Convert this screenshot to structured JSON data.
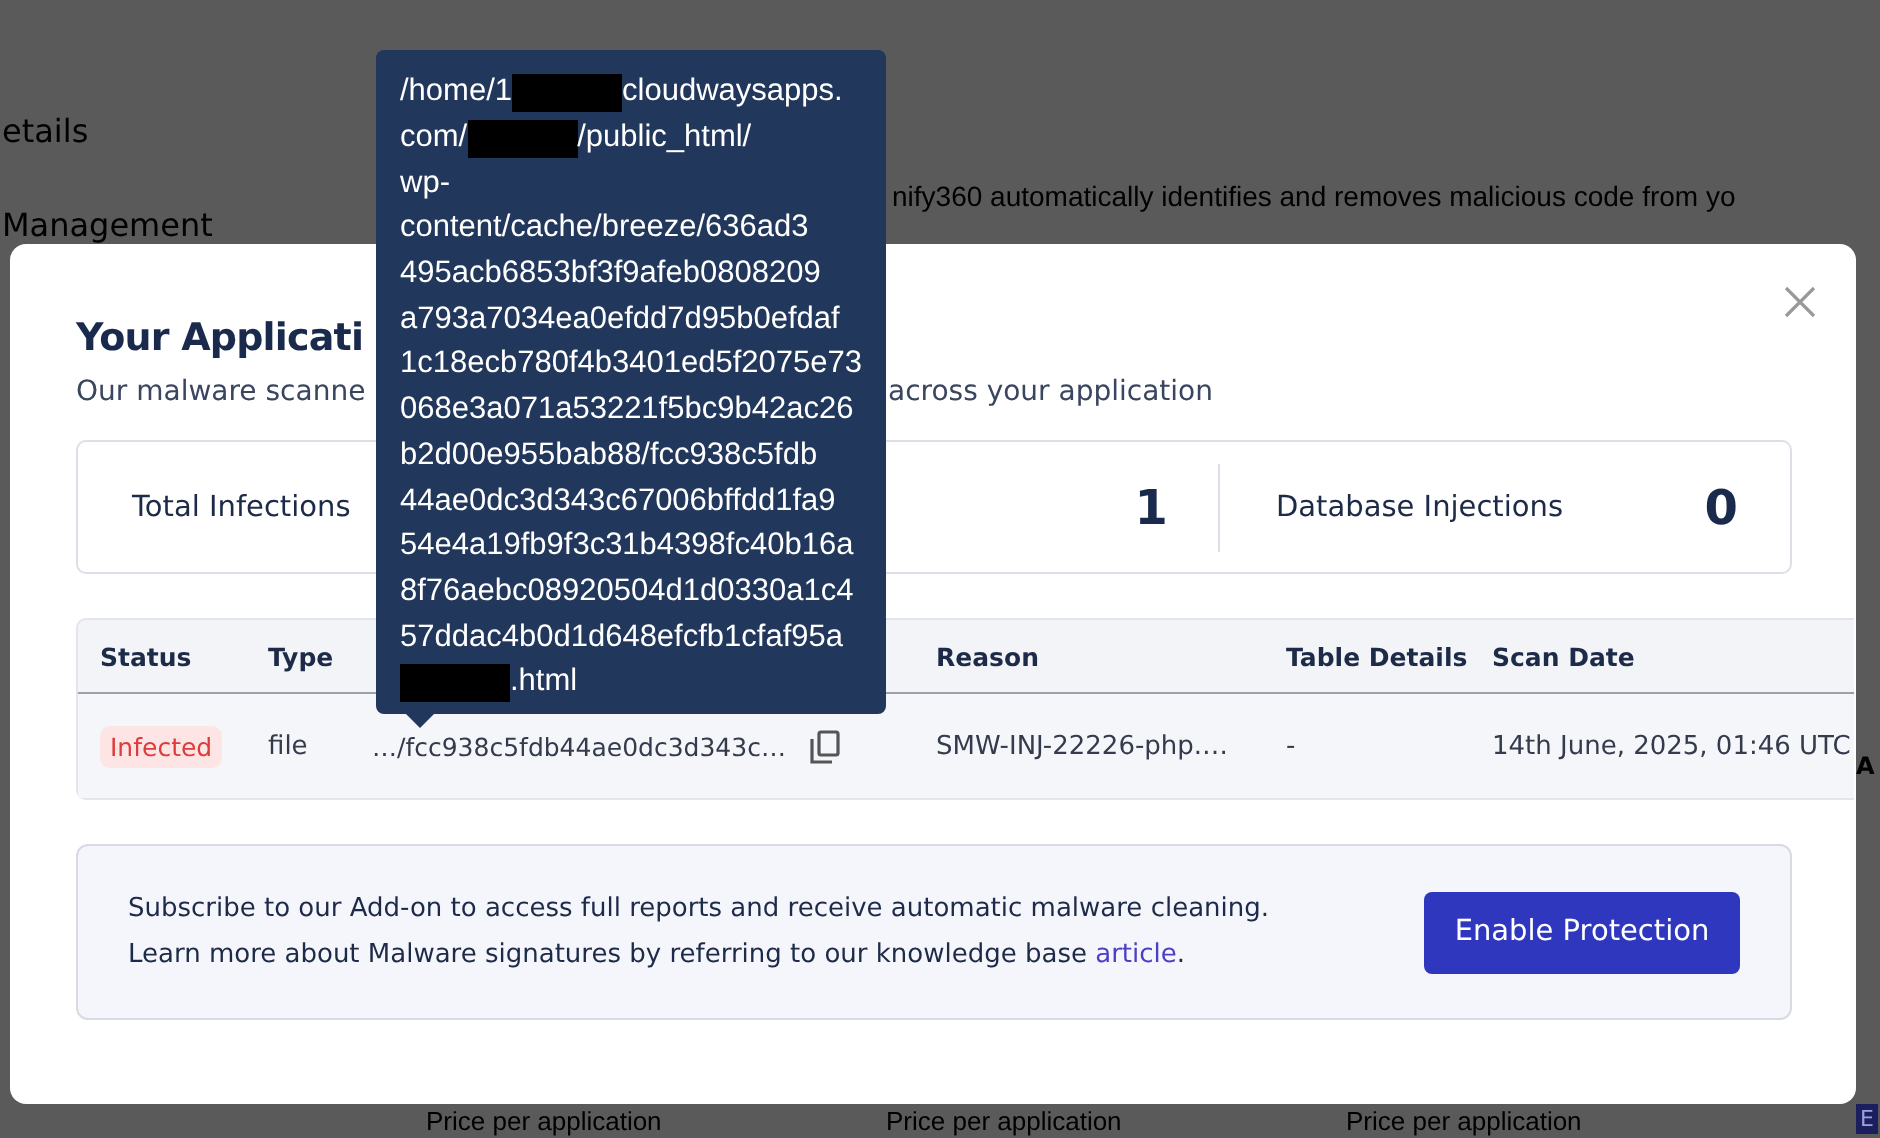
{
  "background": {
    "sidebar_items": [
      "etails",
      "Management"
    ],
    "description": "nify360 automatically identifies and removes malicious code from yo",
    "price_labels": [
      "Price per application",
      "Price per application",
      "Price per application"
    ],
    "side_heading": "A",
    "side_button": "E"
  },
  "modal": {
    "title": "Your Applicati",
    "subtitle_parts": [
      "Our malware scanne",
      "across your application"
    ],
    "stats": [
      {
        "label": "Total Infections"
      },
      {
        "value": "1"
      },
      {
        "label": "Database Injections",
        "value": "0"
      }
    ],
    "table": {
      "columns": [
        "Status",
        "Type",
        null,
        "Reason",
        "Table Details",
        "Scan Date"
      ],
      "rows": [
        {
          "status": "Infected",
          "type": "file",
          "path": "…/fcc938c5fdb44ae0dc3d343c…",
          "reason": "SMW-INJ-22226-php.…",
          "table_details": "-",
          "scan_date": "14th June, 2025, 01:46 UTC"
        }
      ]
    },
    "promo": {
      "line1": "Subscribe to our Add-on to access full reports and receive automatic malware cleaning.",
      "line2_before": "Learn more about Malware signatures by referring to our knowledge base",
      "link": "article",
      "line2_after": "."
    },
    "button": "Enable Protection",
    "tooltip": {
      "lines": [
        [
          {
            "kind": "text",
            "text": "/home/1"
          },
          {
            "kind": "redacted"
          },
          {
            "kind": "text",
            "text": "cloudwaysapps."
          }
        ],
        [
          {
            "kind": "text",
            "text": "com/"
          },
          {
            "kind": "redacted"
          },
          {
            "kind": "text",
            "text": "/public_html/"
          }
        ],
        [
          {
            "kind": "text",
            "text": "wp-"
          }
        ],
        [
          {
            "kind": "text",
            "text": "content/cache/breeze/636ad3"
          }
        ],
        [
          {
            "kind": "text",
            "text": "495acb6853bf3f9afeb0808209"
          }
        ],
        [
          {
            "kind": "text",
            "text": "a793a7034ea0efdd7d95b0efdaf"
          }
        ],
        [
          {
            "kind": "text",
            "text": "1c18ecb780f4b3401ed5f2075e73"
          }
        ],
        [
          {
            "kind": "text",
            "text": "068e3a071a53221f5bc9b42ac26"
          }
        ],
        [
          {
            "kind": "text",
            "text": "b2d00e955bab88/fcc938c5fdb"
          }
        ],
        [
          {
            "kind": "text",
            "text": "44ae0dc3d343c67006bffdd1fa9"
          }
        ],
        [
          {
            "kind": "text",
            "text": "54e4a19fb9f3c31b4398fc40b16a"
          }
        ],
        [
          {
            "kind": "text",
            "text": "8f76aebc08920504d1d0330a1c4"
          }
        ],
        [
          {
            "kind": "text",
            "text": "57ddac4b0d1d648efcfb1cfaf95a"
          }
        ],
        [
          {
            "kind": "redacted"
          },
          {
            "kind": "text",
            "text": ".html"
          }
        ]
      ]
    }
  }
}
